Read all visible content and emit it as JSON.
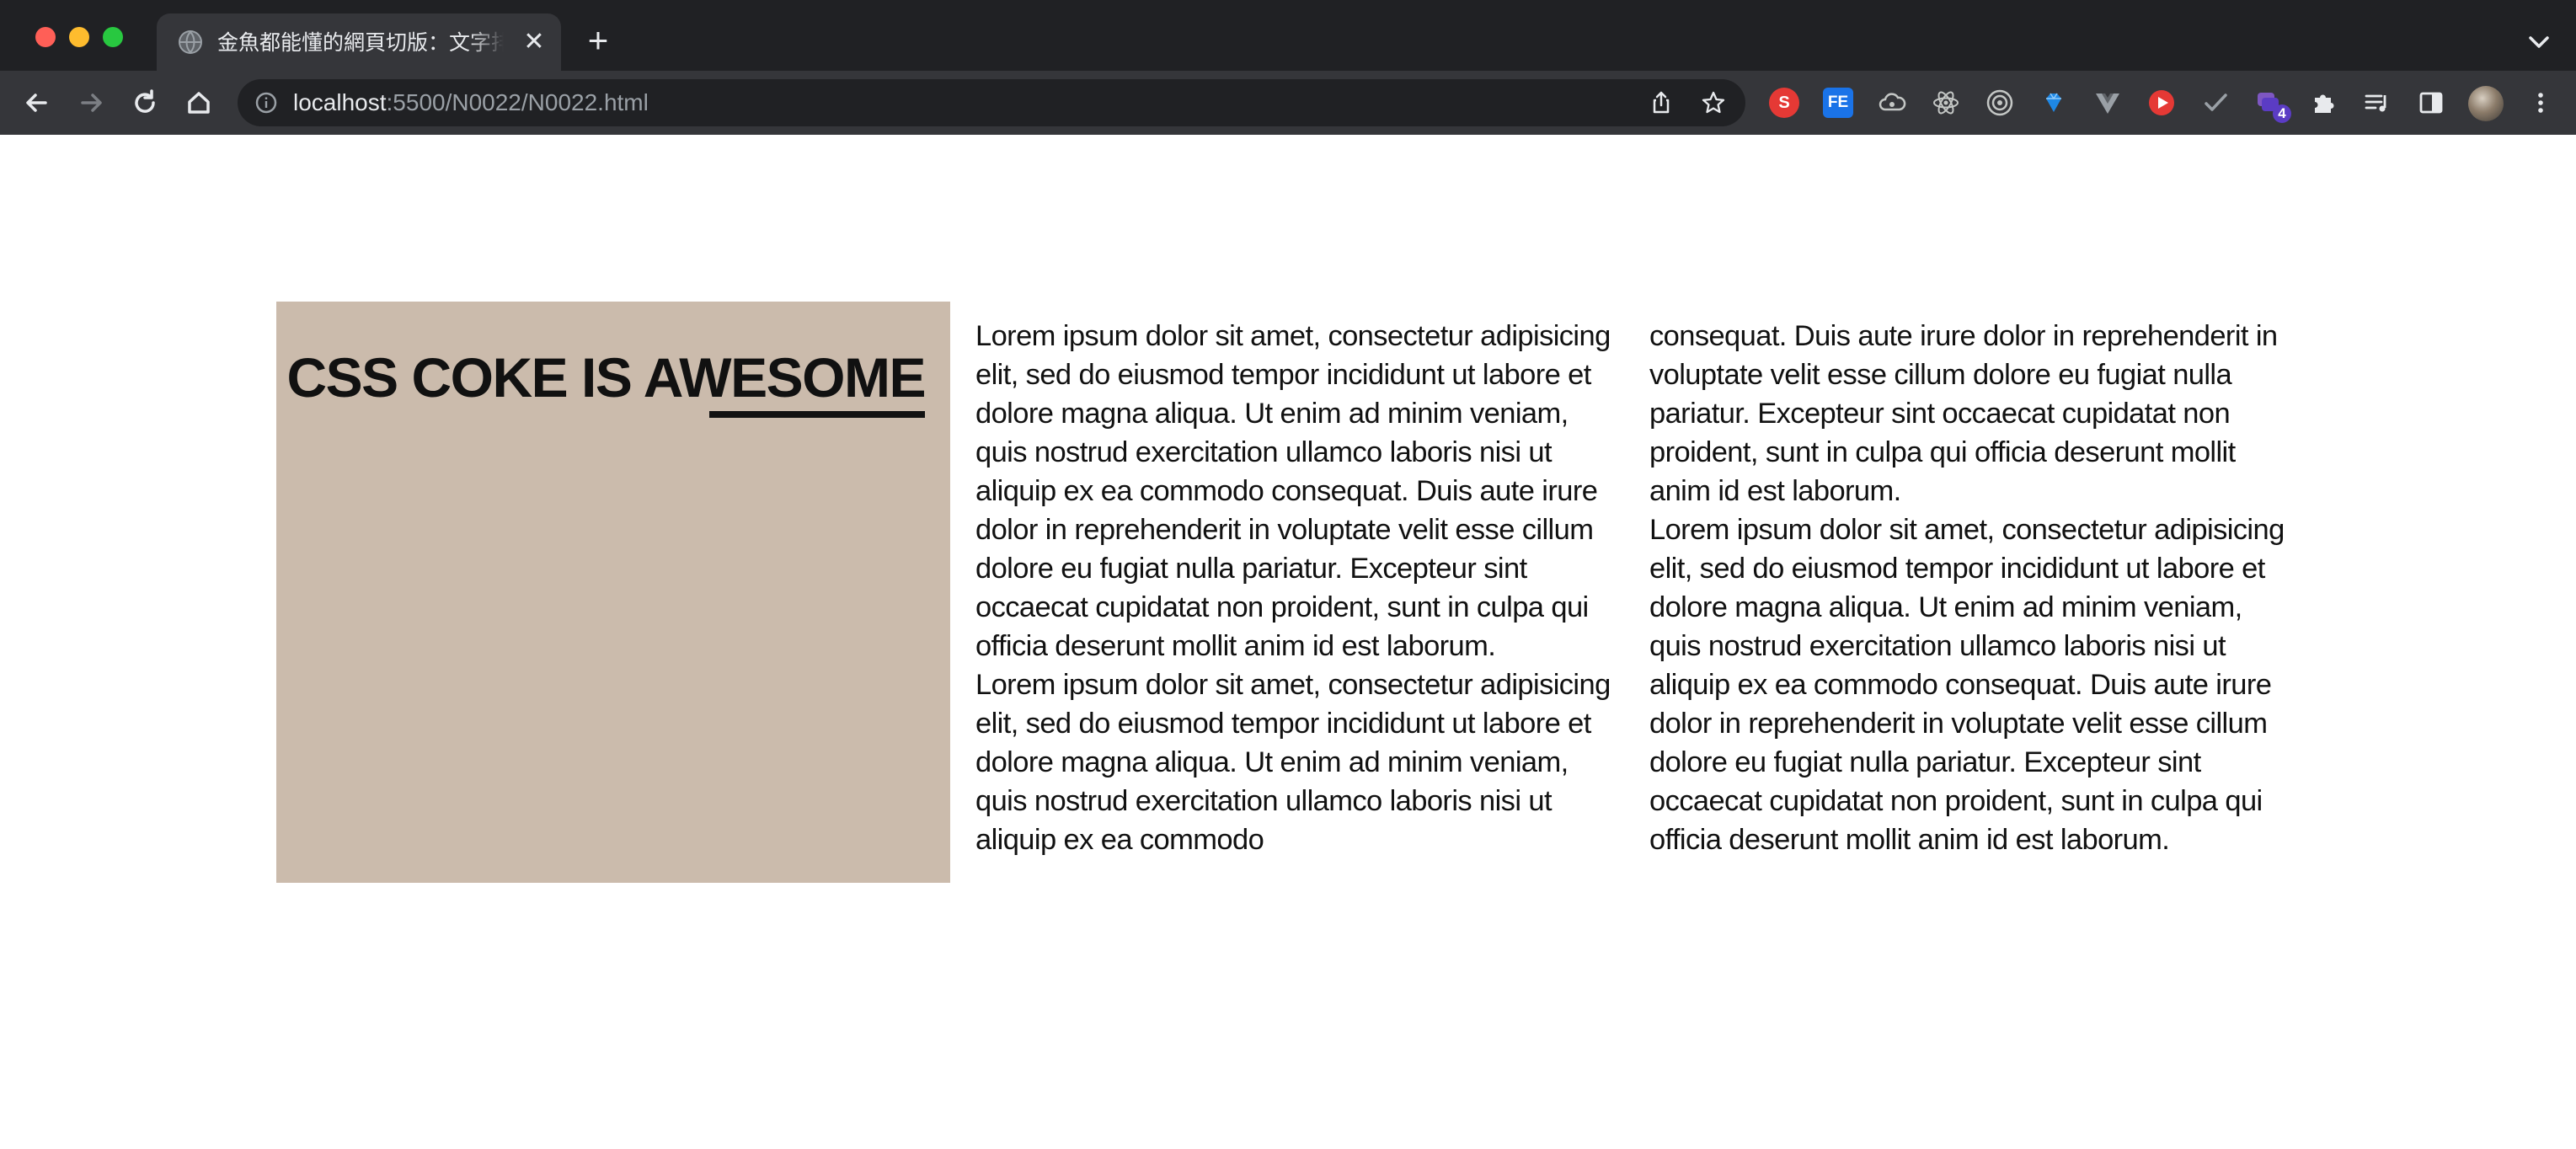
{
  "browser": {
    "tab": {
      "title": "金魚都能懂的網頁切版：文字排版",
      "close_glyph": "✕"
    },
    "new_tab_glyph": "+",
    "address": {
      "host": "localhost",
      "path": ":5500/N0022/N0022.html"
    },
    "icons": {
      "favicon": "globe-icon",
      "back": "back-arrow-icon",
      "forward": "forward-arrow-icon",
      "reload": "reload-icon",
      "home": "home-icon",
      "info": "info-icon",
      "share": "share-icon",
      "bookmark": "star-icon",
      "extensions": "puzzle-icon",
      "media": "media-control-icon",
      "side_panel": "side-panel-icon",
      "menu": "kebab-menu-icon",
      "tab_search": "chevron-down-icon"
    },
    "extensions": [
      {
        "name": "s-extension-icon",
        "label": "S",
        "color": "#e53935"
      },
      {
        "name": "fe-extension-icon",
        "label": "FE",
        "color": "#1a73e8"
      },
      {
        "name": "cloud-extension-icon",
        "label": "",
        "color": "#9aa0a6"
      },
      {
        "name": "react-devtools-icon",
        "label": "",
        "color": "#9aa0a6"
      },
      {
        "name": "target-extension-icon",
        "label": "",
        "color": "#9aa0a6"
      },
      {
        "name": "gem-extension-icon",
        "label": "",
        "color": "#1e88e5"
      },
      {
        "name": "vue-devtools-icon",
        "label": "",
        "color": "#9aa0a6"
      },
      {
        "name": "youtube-extension-icon",
        "label": "",
        "color": "#e53935"
      },
      {
        "name": "check-extension-icon",
        "label": "",
        "color": "#9aa0a6"
      },
      {
        "name": "stack-extension-icon",
        "label": "4",
        "color": "#5b3cc4"
      }
    ]
  },
  "content": {
    "hero_title_plain": "CSS COKE IS AW",
    "hero_title_emph": "ESOME",
    "lorem_paragraph": "Lorem ipsum dolor sit amet, consectetur adipisicing elit, sed do eiusmod tempor incididunt ut labore et dolore magna aliqua. Ut enim ad minim veniam, quis nostrud exercitation ullamco laboris nisi ut aliquip ex ea commodo consequat. Duis aute irure dolor in reprehenderit in voluptate velit esse cillum dolore eu fugiat nulla pariatur. Excepteur sint occaecat cupidatat non proident, sunt in culpa qui officia deserunt mollit anim id est laborum.",
    "col1_p2_visible": "Lorem ipsum dolor sit amet, consectetur adipisicing elit, sed do eiusmod tempor incididunt ut labore et dolore magna aliqua. Ut enim ad minim veniam, quis nostrud exercitation ullamco laboris nisi ut aliquip ex ea commodo",
    "col2_continuation": "consequat. Duis aute irure dolor in reprehenderit in voluptate velit esse cillum dolore eu fugiat nulla pariatur. Excepteur sint occaecat cupidatat non proident, sunt in culpa qui officia deserunt mollit anim id est laborum."
  }
}
